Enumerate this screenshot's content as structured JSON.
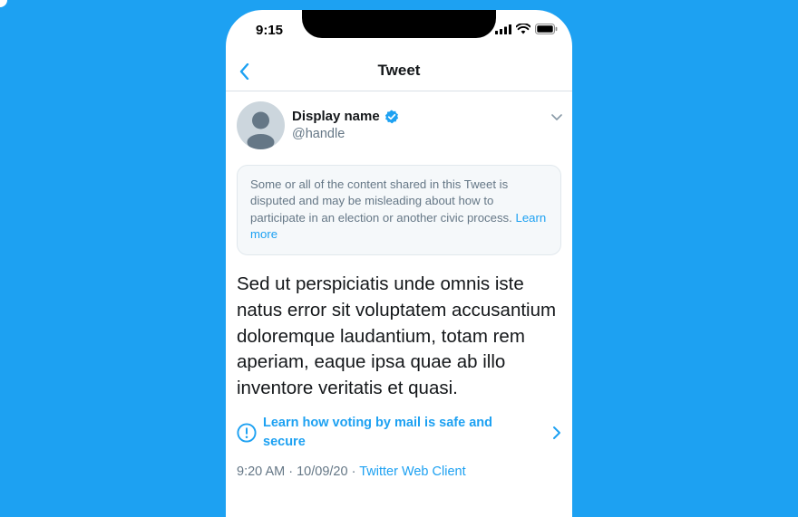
{
  "status_bar": {
    "time": "9:15"
  },
  "nav": {
    "title": "Tweet"
  },
  "author": {
    "display_name": "Display name",
    "handle": "@handle"
  },
  "notice": {
    "text": "Some or all of the content shared in this Tweet is disputed and may be misleading about how to participate in an election or another civic process.",
    "link": "Learn more"
  },
  "tweet": {
    "text": "Sed ut perspiciatis unde omnis iste natus error sit voluptatem accusantium doloremque laudantium, totam rem aperiam, eaque ipsa quae ab illo inventore veritatis et quasi."
  },
  "voting_prompt": {
    "text": "Learn how voting by mail is safe and secure"
  },
  "meta": {
    "time": "9:20 AM",
    "date": "10/09/20",
    "client": "Twitter Web Client"
  },
  "colors": {
    "accent": "#1DA1F2",
    "background": "#1DA1F2"
  },
  "icons": [
    "back-chevron-icon",
    "verified-badge-icon",
    "caret-down-icon",
    "alert-circle-icon",
    "chevron-right-icon",
    "signal-icon",
    "wifi-icon",
    "battery-icon"
  ]
}
